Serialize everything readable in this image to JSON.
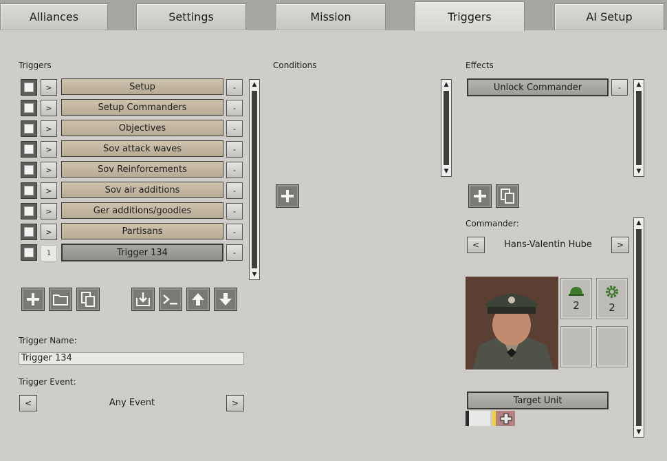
{
  "tabs": [
    {
      "label": "Alliances",
      "active": false
    },
    {
      "label": "Settings",
      "active": false
    },
    {
      "label": "Mission",
      "active": false
    },
    {
      "label": "Triggers",
      "active": true
    },
    {
      "label": "AI Setup",
      "active": false
    }
  ],
  "triggers": {
    "heading": "Triggers",
    "items": [
      {
        "label": "Setup",
        "toggle": ">",
        "remove": "-"
      },
      {
        "label": "Setup Commanders",
        "toggle": ">",
        "remove": "-"
      },
      {
        "label": "Objectives",
        "toggle": ">",
        "remove": "-"
      },
      {
        "label": "Sov attack waves",
        "toggle": ">",
        "remove": "-"
      },
      {
        "label": "Sov Reinforcements",
        "toggle": ">",
        "remove": "-"
      },
      {
        "label": "Sov air additions",
        "toggle": ">",
        "remove": "-"
      },
      {
        "label": "Ger additions/goodies",
        "toggle": ">",
        "remove": "-"
      },
      {
        "label": "Partisans",
        "toggle": ">",
        "remove": "-"
      },
      {
        "label": "Trigger 134",
        "toggle": "1",
        "remove": "-",
        "selected": true
      }
    ],
    "toolbar_icons": [
      "add-icon",
      "folder-icon",
      "copy-icon",
      "import-icon",
      "console-icon",
      "arrow-up-icon",
      "arrow-down-icon"
    ]
  },
  "trigger_name": {
    "label": "Trigger Name:",
    "value": "Trigger 134"
  },
  "trigger_event": {
    "label": "Trigger Event:",
    "value": "Any Event",
    "prev": "<",
    "next": ">"
  },
  "conditions": {
    "heading": "Conditions"
  },
  "effects": {
    "heading": "Effects",
    "items": [
      {
        "label": "Unlock Commander",
        "remove": "-"
      }
    ]
  },
  "commander": {
    "label": "Commander:",
    "name": "Hans-Valentin Hube",
    "prev": "<",
    "next": ">",
    "slots": [
      {
        "icon": "helmet-icon",
        "value": "2"
      },
      {
        "icon": "gear-icon",
        "value": "2"
      }
    ]
  },
  "target_unit": {
    "label": "Target Unit"
  },
  "colors": {
    "trigger_row": "#c3b7a1",
    "selected_row": "#9c9b98",
    "panel": "#cfcdc9"
  }
}
